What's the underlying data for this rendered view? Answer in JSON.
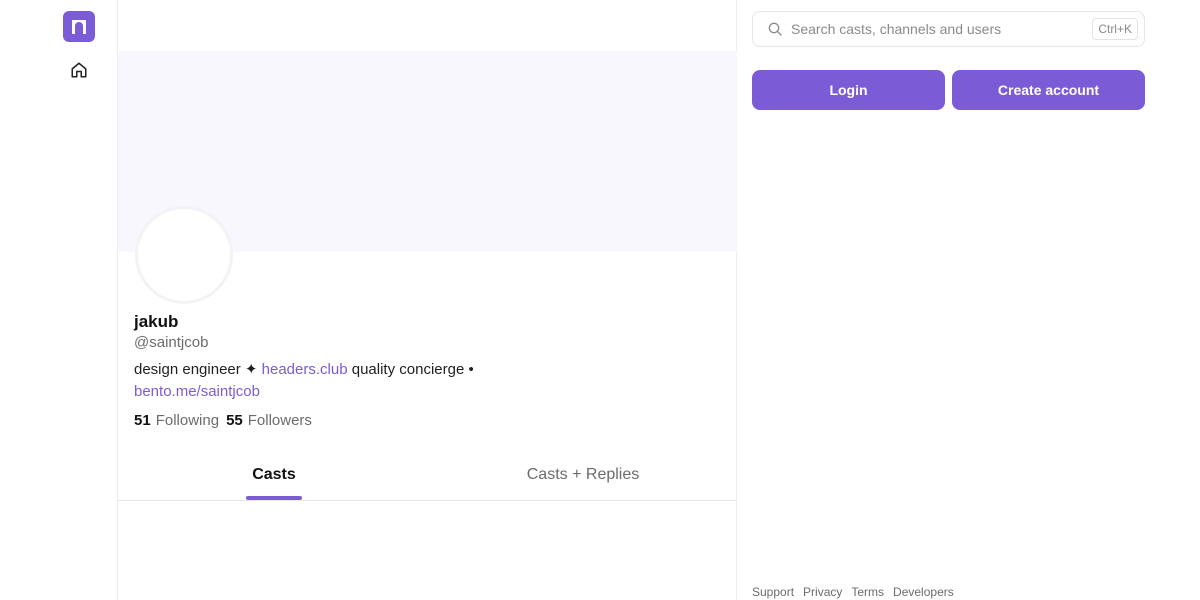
{
  "profile": {
    "name": "jakub",
    "handle": "@saintjcob",
    "bio_prefix": "design engineer ✦ ",
    "bio_link1": "headers.club",
    "bio_middle": " quality concierge •",
    "bio_link2": "bento.me/saintjcob",
    "following_count": "51",
    "following_label": "Following",
    "followers_count": "55",
    "followers_label": "Followers"
  },
  "tabs": [
    {
      "label": "Casts",
      "active": true
    },
    {
      "label": "Casts + Replies",
      "active": false
    }
  ],
  "search": {
    "placeholder": "Search casts, channels and users",
    "shortcut": "Ctrl+K"
  },
  "auth": {
    "login_label": "Login",
    "create_label": "Create account"
  },
  "footer": {
    "links": [
      "Support",
      "Privacy",
      "Terms",
      "Developers"
    ]
  },
  "icons": {
    "logo": "farcaster-logo-icon",
    "home": "home-icon",
    "search": "search-icon"
  },
  "colors": {
    "accent": "#7c5cd6",
    "banner": "#f7f7fd"
  }
}
